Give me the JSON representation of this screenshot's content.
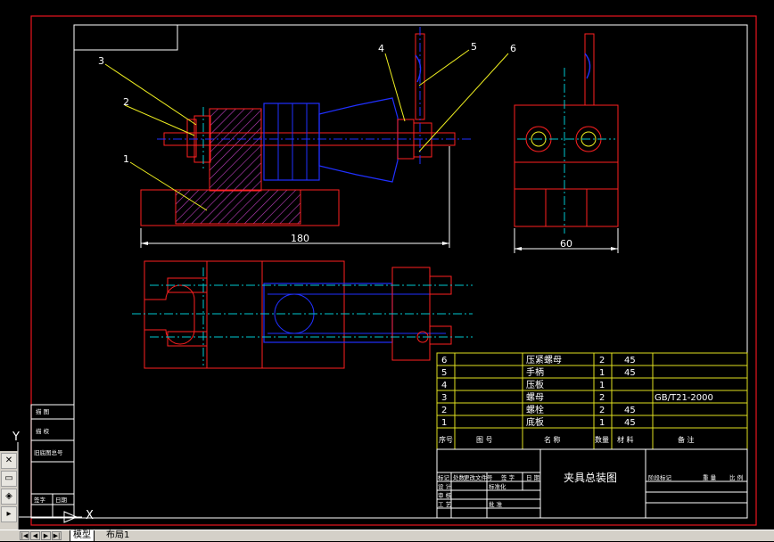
{
  "colors": {
    "background": "#000000",
    "border_red": "#e8141e",
    "frame_white": "#ffffff",
    "part_red": "#ff2020",
    "hatch_magenta": "#c040c0",
    "center_blue": "#2030ff",
    "center_cyan": "#00c8d0",
    "leader_yellow": "#f0f020",
    "table_yellow": "#e0e020",
    "text_white": "#ffffff"
  },
  "drawing": {
    "dim_front_width": "180",
    "dim_side_width": "60",
    "balloons": [
      "1",
      "2",
      "3",
      "4",
      "5",
      "6"
    ],
    "ucs_y": "Y",
    "ucs_x": "X"
  },
  "parts_table": {
    "rows": [
      {
        "no": "6",
        "name": "压紧螺母",
        "qty": "2",
        "material": "45",
        "note": ""
      },
      {
        "no": "5",
        "name": "手柄",
        "qty": "1",
        "material": "45",
        "note": ""
      },
      {
        "no": "4",
        "name": "压板",
        "qty": "1",
        "material": "",
        "note": ""
      },
      {
        "no": "3",
        "name": "螺母",
        "qty": "2",
        "material": "",
        "note": "GB/T21-2000"
      },
      {
        "no": "2",
        "name": "螺栓",
        "qty": "2",
        "material": "45",
        "note": ""
      },
      {
        "no": "1",
        "name": "底板",
        "qty": "1",
        "material": "45",
        "note": ""
      }
    ],
    "header": [
      "序号",
      "图 号",
      "名 称",
      "数量",
      "材 料",
      "备 注"
    ]
  },
  "title_block": {
    "title": "夹具总装图",
    "small_labels": [
      "标记",
      "处数",
      "更改文件号",
      "签 字",
      "日 期",
      "设 计",
      "标准化",
      "审 核",
      "工 艺",
      "批 准",
      "阶段标记",
      "重 量",
      "比 例"
    ]
  },
  "side_table": {
    "labels": [
      "描 图",
      "描 校",
      "旧底图总号",
      "签字",
      "日期"
    ]
  },
  "toolbar": {
    "icons": [
      "close-icon",
      "window-icon",
      "panel-icon",
      "cursor-icon"
    ]
  },
  "status": {
    "tabs": [
      "模型",
      "布局1"
    ]
  }
}
